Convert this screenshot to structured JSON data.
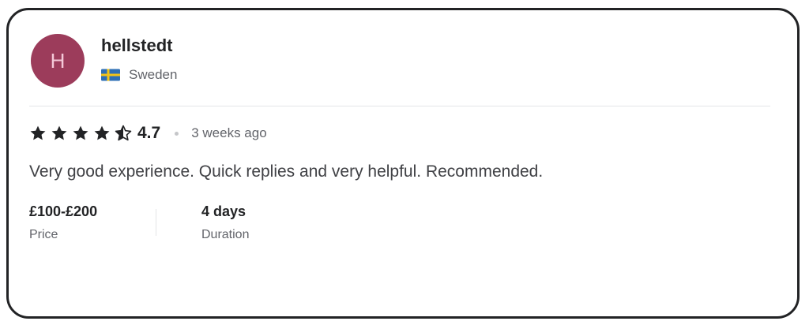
{
  "reviewer": {
    "initial": "H",
    "username": "hellstedt",
    "country": "Sweden",
    "flag_icon": "sweden-flag-icon",
    "avatar_color": "#9c3c5b"
  },
  "review": {
    "rating": "4.7",
    "rating_number": 4.7,
    "stars_max": 5,
    "star_icon": "star-icon",
    "time_ago": "3 weeks ago",
    "text": "Very good experience. Quick replies and very helpful. Recommended."
  },
  "details": {
    "price_value": "£100-£200",
    "price_label": "Price",
    "duration_value": "4 days",
    "duration_label": "Duration"
  },
  "colors": {
    "text_primary": "#222325",
    "text_secondary": "#62646a",
    "divider": "#e4e5e7"
  }
}
